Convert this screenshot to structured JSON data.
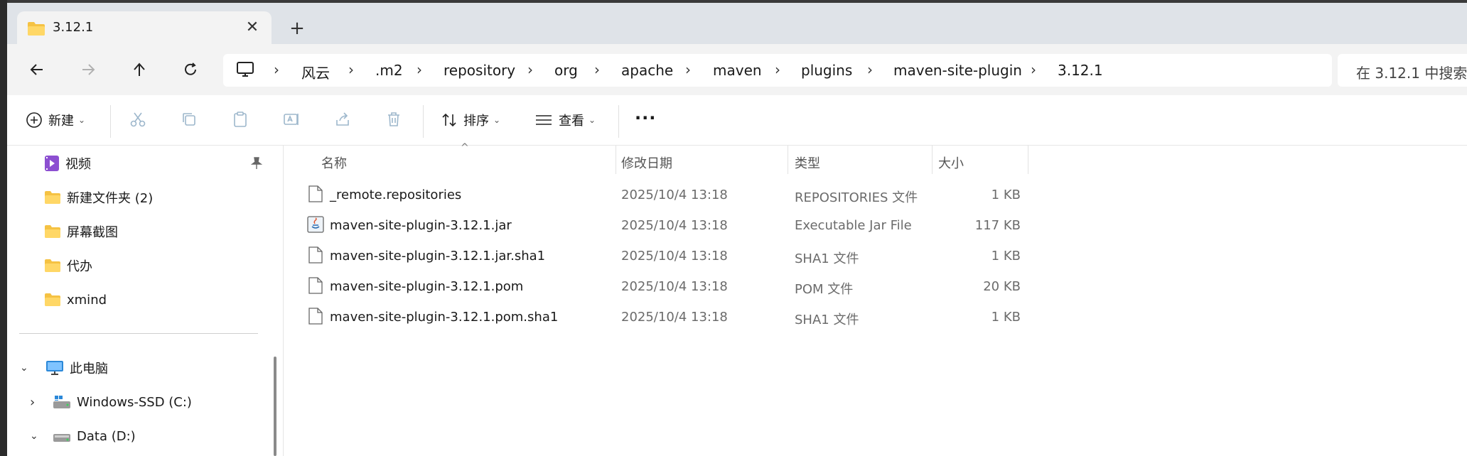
{
  "tab": {
    "title": "3.12.1",
    "close": "✕",
    "new_tab": "+"
  },
  "address": {
    "crumbs": [
      "风云",
      ".m2",
      "repository",
      "org",
      "apache",
      "maven",
      "plugins",
      "maven-site-plugin",
      "3.12.1"
    ],
    "separator": "›"
  },
  "search": {
    "placeholder": "在 3.12.1 中搜索"
  },
  "toolbar": {
    "new_label": "新建",
    "sort_label": "排序",
    "view_label": "查看",
    "more_label": "···"
  },
  "sidebar": {
    "quick_access": [
      {
        "label": "视频",
        "icon": "video-folder-icon",
        "pinned": true
      },
      {
        "label": "新建文件夹 (2)",
        "icon": "folder-icon"
      },
      {
        "label": "屏幕截图",
        "icon": "folder-icon"
      },
      {
        "label": "代办",
        "icon": "folder-icon"
      },
      {
        "label": "xmind",
        "icon": "folder-icon"
      }
    ],
    "this_pc": "此电脑",
    "drives": [
      {
        "label": "Windows-SSD (C:)",
        "expanded": false
      },
      {
        "label": "Data (D:)",
        "expanded": true
      }
    ]
  },
  "columns": {
    "name": "名称",
    "modified": "修改日期",
    "type": "类型",
    "size": "大小"
  },
  "files": [
    {
      "name": "_remote.repositories",
      "modified": "2025/10/4 13:18",
      "type": "REPOSITORIES 文件",
      "size": "1 KB",
      "icon": "file-icon"
    },
    {
      "name": "maven-site-plugin-3.12.1.jar",
      "modified": "2025/10/4 13:18",
      "type": "Executable Jar File",
      "size": "117 KB",
      "icon": "jar-icon"
    },
    {
      "name": "maven-site-plugin-3.12.1.jar.sha1",
      "modified": "2025/10/4 13:18",
      "type": "SHA1 文件",
      "size": "1 KB",
      "icon": "file-icon"
    },
    {
      "name": "maven-site-plugin-3.12.1.pom",
      "modified": "2025/10/4 13:18",
      "type": "POM 文件",
      "size": "20 KB",
      "icon": "file-icon"
    },
    {
      "name": "maven-site-plugin-3.12.1.pom.sha1",
      "modified": "2025/10/4 13:18",
      "type": "SHA1 文件",
      "size": "1 KB",
      "icon": "file-icon"
    }
  ],
  "colors": {
    "folder": "#f5c243",
    "accent": "#0067c0",
    "tabbar": "#dfe3e8"
  }
}
